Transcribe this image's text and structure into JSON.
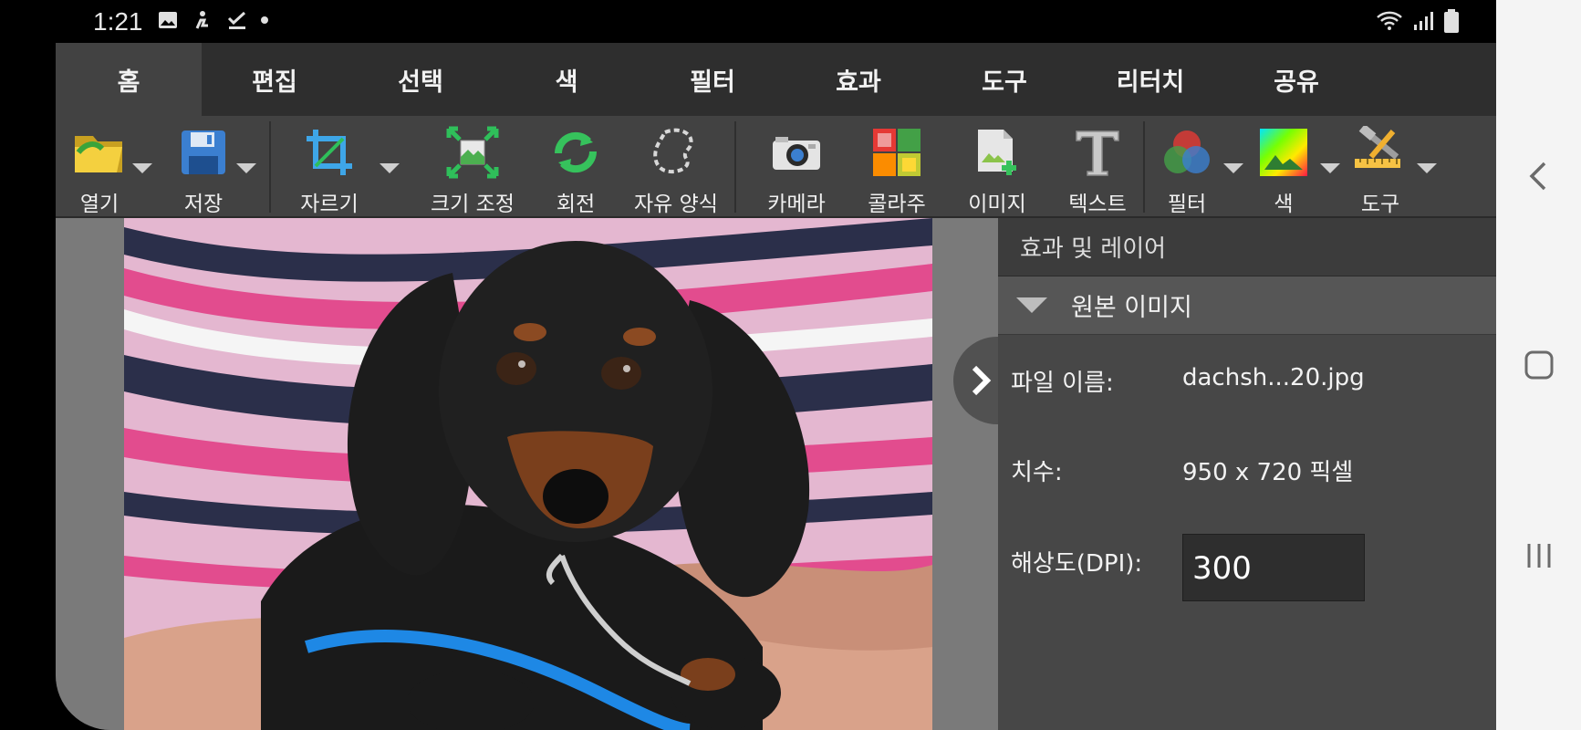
{
  "status_bar": {
    "time": "1:21"
  },
  "tabs": [
    {
      "label": "홈"
    },
    {
      "label": "편집"
    },
    {
      "label": "선택"
    },
    {
      "label": "색"
    },
    {
      "label": "필터"
    },
    {
      "label": "효과"
    },
    {
      "label": "도구"
    },
    {
      "label": "리터치"
    },
    {
      "label": "공유"
    }
  ],
  "toolbar": {
    "open": "열기",
    "save": "저장",
    "crop": "자르기",
    "resize": "크기 조정",
    "rotate": "회전",
    "freeform": "자유 양식",
    "camera": "카메라",
    "collage": "콜라주",
    "image": "이미지",
    "text": "텍스트",
    "filter": "필터",
    "color": "색",
    "tools": "도구"
  },
  "panel": {
    "title": "효과 및 레이어",
    "section": "원본 이미지",
    "filename_label": "파일 이름:",
    "filename_value": "dachsh...20.jpg",
    "dimensions_label": "치수:",
    "dimensions_value": "950 x 720 픽셀",
    "dpi_label": "해상도(DPI):",
    "dpi_value": "300"
  },
  "colors": {
    "accent_active_tab": "#424242",
    "panel_bg": "#474747"
  }
}
